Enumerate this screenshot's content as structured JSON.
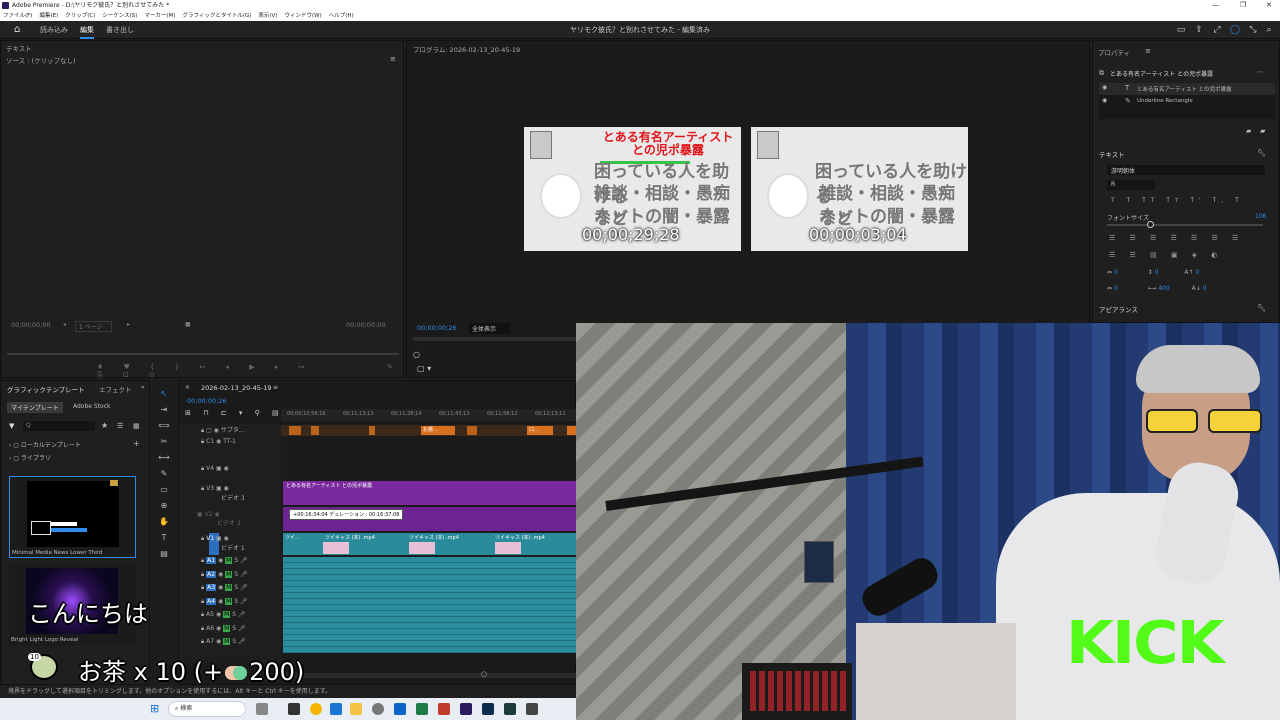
{
  "app": {
    "title": "Adobe Premiere - D:\\ヤリモク彼氏？と別れさせてみた *",
    "menus": [
      "ファイル(F)",
      "編集(E)",
      "クリップ(C)",
      "シーケンス(S)",
      "マーカー(M)",
      "グラフィックとタイトル(G)",
      "表示(V)",
      "ウィンドウ(W)",
      "ヘルプ(H)"
    ],
    "window_controls": [
      "—",
      "❐",
      "✕"
    ]
  },
  "workspace": {
    "tabs": [
      "読み込み",
      "編集",
      "書き出し"
    ],
    "active_tab": "編集",
    "project_title": "ヤリモク彼氏？と別れさせてみた - 編集済み"
  },
  "source_panel": {
    "tab": "テキスト",
    "source_label": "ソース : (クリップなし)",
    "timecode_left": "00;00;00;00",
    "page_select": "1 ページ",
    "timecode_right": "00;00;00;00"
  },
  "program_monitor": {
    "title": "プログラム: 2026-02-13_20-45-19",
    "timecode": "00;00;00;26",
    "zoom": "全体表示",
    "frames": [
      {
        "header_red": "とある有名アーティスト",
        "header_red2": "との児ポ暴露",
        "line1": "困っている人を助ける",
        "line2": "雑談・相談・愚痴など",
        "line3": "ネットの闇・暴露",
        "timecode": "00;00;29;28"
      },
      {
        "line1": "困っている人を助ける",
        "line2": "雑談・相談・愚痴など",
        "line3": "ネットの闇・暴露",
        "timecode": "00;00;03;04"
      }
    ]
  },
  "properties": {
    "title": "プロパティ",
    "clip_name": "とある有名アーティスト との児ポ暴露",
    "layers": [
      "とある有名アーティスト との児ポ暴露",
      "Underline Rectangle"
    ],
    "text_section": "テキスト",
    "font_name": "游明朝体",
    "font_style": "R",
    "font_size_label": "フォントサイズ",
    "font_size_value": "106",
    "appearance_section": "アピアランス",
    "kerning_values": [
      "0",
      "0",
      "0",
      "0",
      "400",
      "0"
    ]
  },
  "graphic_templates": {
    "tabs": [
      "グラフィックテンプレート",
      "エフェクト"
    ],
    "subtabs": [
      "マイテンプレート",
      "Adobe Stock"
    ],
    "search_placeholder": "Q",
    "tree": [
      "ローカルテンプレート",
      "ライブラリ"
    ],
    "items": [
      "Minimal Media News Lower Third",
      "Bright Light Logo Reveal"
    ]
  },
  "timeline": {
    "sequence_name": "2026-02-13_20-45-19",
    "timecode": "00;00;00;26",
    "ruler": [
      "00;00;10;58;16",
      "00;11;13;13",
      "00;11;28;14",
      "00;11;43;13",
      "00;11;58;12",
      "00;12;13;11"
    ],
    "tracks_video": [
      "サブタ…",
      "C1",
      "V4",
      "V3",
      "V2",
      "V1"
    ],
    "track_labels": {
      "c1": "TT-1",
      "v3": "ビデオ 3",
      "v2": "ビデオ 2",
      "v1": "ビデオ 1"
    },
    "tracks_audio": [
      "A1",
      "A2",
      "A3",
      "A4",
      "A5",
      "A6",
      "A7"
    ],
    "caption_clips": [
      "お悪…",
      "口…"
    ],
    "v3_clip": "とある有名アーティスト との児ポ暴露",
    "v2_tooltip": "+00:16:34:04 デュレーション : 00:16:37:08",
    "v1_clips": [
      "ツイ…",
      "ツイキャス (本) .mp4",
      "ツイキャス (本) .mp4",
      "ツイキャス (本) .mp4"
    ]
  },
  "status_bar": {
    "text": "境界をドラッグして選択項目をトリミングします。他のオプションを使用するには、Alt キーと Ctrl キーを使用します。"
  },
  "taskbar": {
    "search": "検索"
  },
  "overlay": {
    "greeting": "こんにちは",
    "gift_text": "お茶 x 10 (+",
    "gift_points": "200)",
    "badge_count": "10",
    "brand": "KICK"
  },
  "colors": {
    "accent_blue": "#2d8ceb",
    "clip_purple": "#7a2a9e",
    "clip_teal": "#2a8b9a",
    "kick_green": "#52fc18",
    "monitor_red": "#e0151c"
  }
}
